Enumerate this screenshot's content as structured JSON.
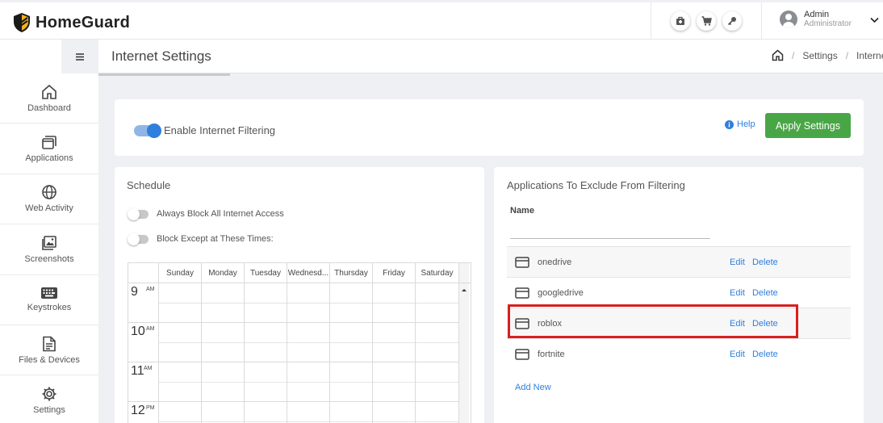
{
  "brand": {
    "name": "HomeGuard"
  },
  "header": {
    "icons": [
      "shopping-bag-icon",
      "cart-icon",
      "key-icon"
    ],
    "user_name": "Admin",
    "user_role": "Administrator"
  },
  "sidebar": {
    "items": [
      {
        "label": "Dashboard",
        "icon": "home-icon"
      },
      {
        "label": "Applications",
        "icon": "applications-icon"
      },
      {
        "label": "Web Activity",
        "icon": "globe-icon"
      },
      {
        "label": "Screenshots",
        "icon": "image-icon"
      },
      {
        "label": "Keystrokes",
        "icon": "keyboard-icon"
      },
      {
        "label": "Files & Devices",
        "icon": "file-icon"
      },
      {
        "label": "Settings",
        "icon": "gear-icon"
      }
    ]
  },
  "page": {
    "title": "Internet Settings",
    "breadcrumb": [
      "Settings",
      "Interne"
    ]
  },
  "filtering": {
    "enable_label": "Enable Internet Filtering",
    "enabled": true,
    "help_label": "Help",
    "apply_label": "Apply Settings"
  },
  "schedule": {
    "title": "Schedule",
    "options": [
      {
        "label": "Always Block All Internet Access",
        "on": false
      },
      {
        "label": "Block Except at These Times:",
        "on": false
      }
    ],
    "days": [
      "Sunday",
      "Monday",
      "Tuesday",
      "Wednesd...",
      "Thursday",
      "Friday",
      "Saturday"
    ],
    "hours": [
      {
        "num": "9",
        "ap": "AM"
      },
      {
        "num": "10",
        "ap": "AM"
      },
      {
        "num": "11",
        "ap": "AM"
      },
      {
        "num": "12",
        "ap": "PM"
      }
    ]
  },
  "exclusions": {
    "title": "Applications To Exclude From Filtering",
    "column": "Name",
    "edit_label": "Edit",
    "delete_label": "Delete",
    "add_label": "Add New",
    "apps": [
      "onedrive",
      "googledrive",
      "roblox",
      "fortnite"
    ]
  },
  "colors": {
    "accent": "#2f7fdd",
    "apply": "#49a646",
    "highlight": "#d8201f"
  }
}
